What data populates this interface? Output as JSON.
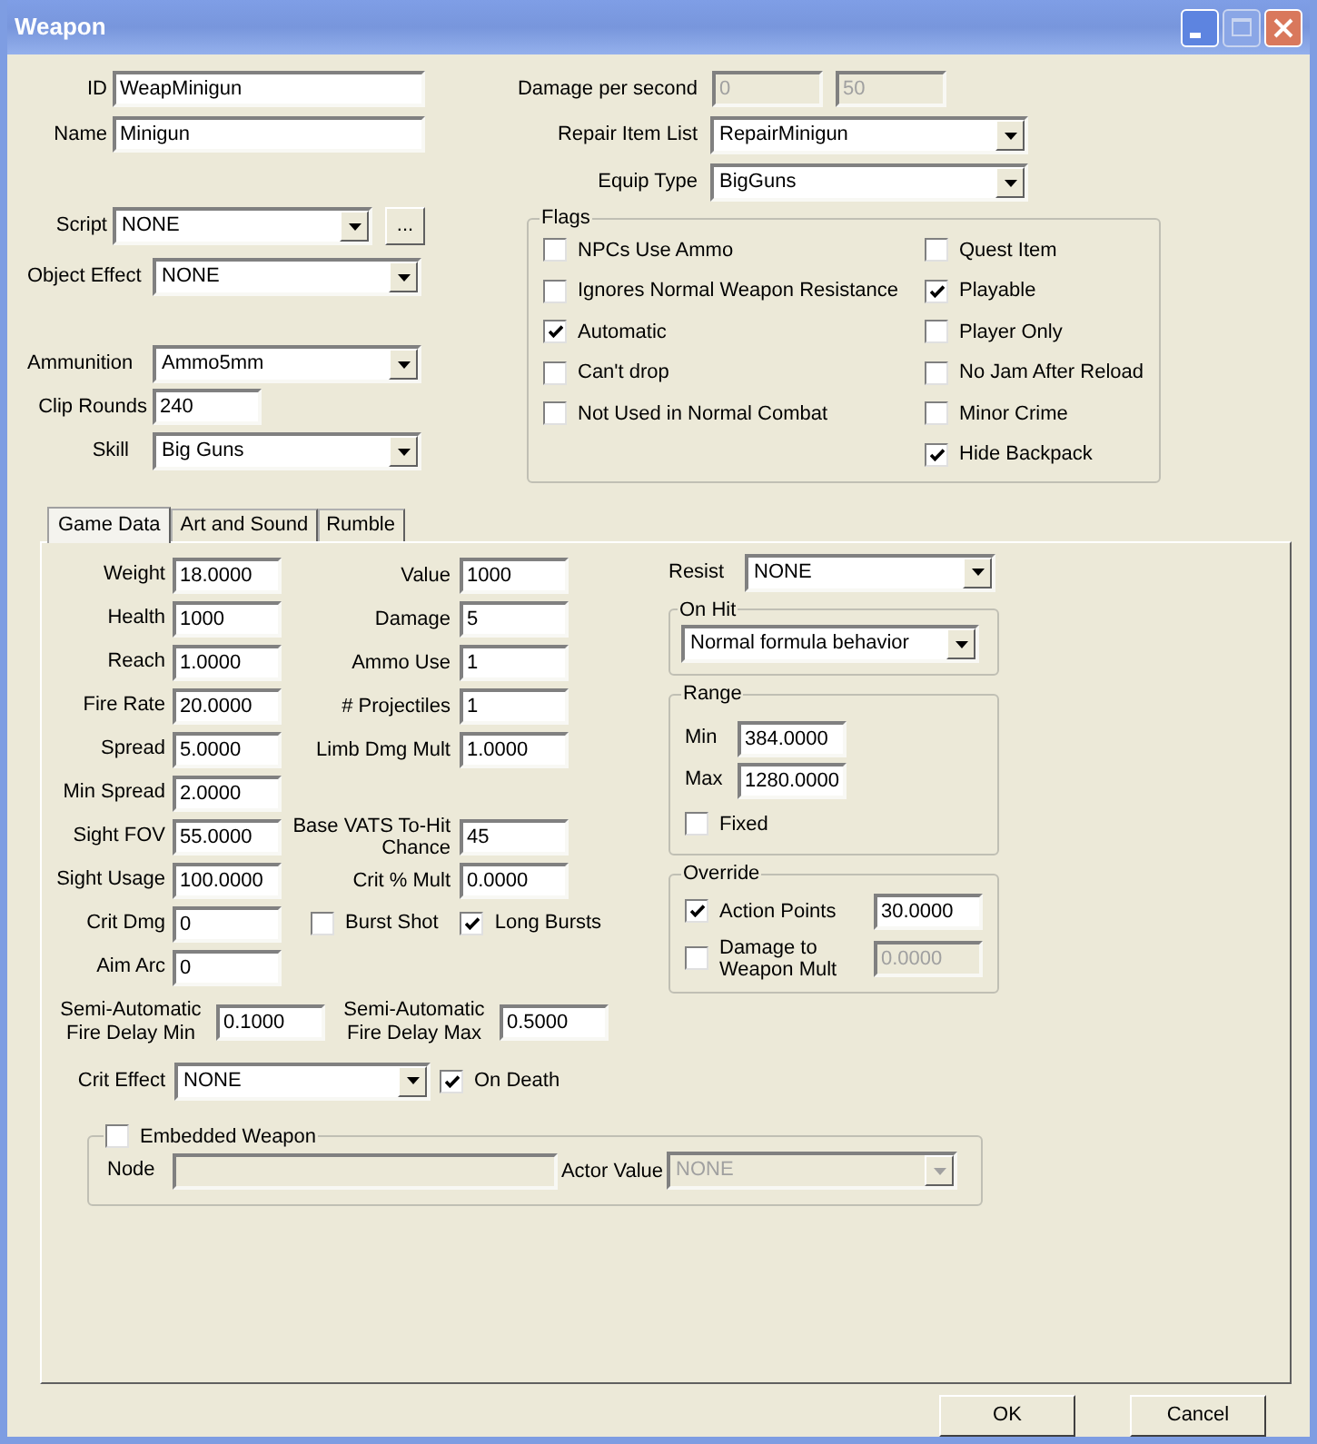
{
  "window": {
    "title": "Weapon"
  },
  "id": {
    "label": "ID",
    "value": "WeapMinigun"
  },
  "name": {
    "label": "Name",
    "value": "Minigun"
  },
  "script": {
    "label": "Script",
    "value": "NONE",
    "button": "..."
  },
  "object_effect": {
    "label": "Object Effect",
    "value": "NONE"
  },
  "ammunition": {
    "label": "Ammunition",
    "value": "Ammo5mm"
  },
  "clip_rounds": {
    "label": "Clip Rounds",
    "value": "240"
  },
  "skill": {
    "label": "Skill",
    "value": "Big Guns"
  },
  "damage_per_second": {
    "label": "Damage per second",
    "values": [
      "0",
      "50"
    ]
  },
  "repair_item_list": {
    "label": "Repair Item List",
    "value": "RepairMinigun"
  },
  "equip_type": {
    "label": "Equip Type",
    "value": "BigGuns"
  },
  "flags": {
    "title": "Flags",
    "left": [
      {
        "label": "NPCs Use Ammo",
        "checked": false
      },
      {
        "label": "Ignores Normal Weapon Resistance",
        "checked": false
      },
      {
        "label": "Automatic",
        "checked": true
      },
      {
        "label": "Can't drop",
        "checked": false
      },
      {
        "label": "Not Used in Normal Combat",
        "checked": false
      }
    ],
    "right": [
      {
        "label": "Quest Item",
        "checked": false
      },
      {
        "label": "Playable",
        "checked": true
      },
      {
        "label": "Player Only",
        "checked": false
      },
      {
        "label": "No Jam After Reload",
        "checked": false
      },
      {
        "label": "Minor Crime",
        "checked": false
      },
      {
        "label": "Hide Backpack",
        "checked": true
      }
    ]
  },
  "tabs": [
    {
      "label": "Game Data",
      "selected": true
    },
    {
      "label": "Art and Sound",
      "selected": false
    },
    {
      "label": "Rumble",
      "selected": false
    }
  ],
  "game_data": {
    "left_fields": [
      {
        "label": "Weight",
        "value": "18.0000"
      },
      {
        "label": "Health",
        "value": "1000"
      },
      {
        "label": "Reach",
        "value": "1.0000"
      },
      {
        "label": "Fire Rate",
        "value": "20.0000"
      },
      {
        "label": "Spread",
        "value": "5.0000"
      },
      {
        "label": "Min Spread",
        "value": "2.0000"
      },
      {
        "label": "Sight FOV",
        "value": "55.0000"
      },
      {
        "label": "Sight Usage",
        "value": "100.0000"
      },
      {
        "label": "Crit Dmg",
        "value": "0"
      },
      {
        "label": "Aim Arc",
        "value": "0"
      }
    ],
    "middle_fields": [
      {
        "label": "Value",
        "value": "1000"
      },
      {
        "label": "Damage",
        "value": "5"
      },
      {
        "label": "Ammo Use",
        "value": "1"
      },
      {
        "label": "# Projectiles",
        "value": "1"
      },
      {
        "label": "Limb Dmg Mult",
        "value": "1.0000"
      },
      {
        "label": "Base VATS To-Hit Chance",
        "value": "45"
      },
      {
        "label": "Crit % Mult",
        "value": "0.0000"
      }
    ],
    "burst_options": [
      {
        "label": "Burst Shot",
        "checked": false
      },
      {
        "label": "Long Bursts",
        "checked": true
      }
    ],
    "semi_auto": [
      {
        "label": "Semi-Automatic Fire Delay Min",
        "value": "0.1000"
      },
      {
        "label": "Semi-Automatic Fire Delay Max",
        "value": "0.5000"
      }
    ],
    "crit_effect": {
      "label": "Crit Effect",
      "value": "NONE",
      "on_death": {
        "label": "On Death",
        "checked": true
      }
    },
    "embedded_weapon": {
      "label": "Embedded Weapon",
      "checked": false,
      "node_label": "Node",
      "actor_value_label": "Actor Value",
      "actor_value": "NONE"
    },
    "resist": {
      "label": "Resist",
      "value": "NONE"
    },
    "on_hit": {
      "title": "On Hit",
      "value": "Normal formula behavior"
    },
    "range": {
      "title": "Range",
      "fields": [
        {
          "label": "Min",
          "value": "384.0000"
        },
        {
          "label": "Max",
          "value": "1280.0000"
        }
      ],
      "fixed": {
        "label": "Fixed",
        "checked": false
      }
    },
    "override": {
      "title": "Override",
      "items": [
        {
          "label": "Action Points",
          "checked": true,
          "value": "30.0000"
        },
        {
          "label": "Damage to Weapon Mult",
          "checked": false,
          "value": "0.0000"
        }
      ]
    }
  },
  "buttons": [
    "OK",
    "Cancel"
  ]
}
